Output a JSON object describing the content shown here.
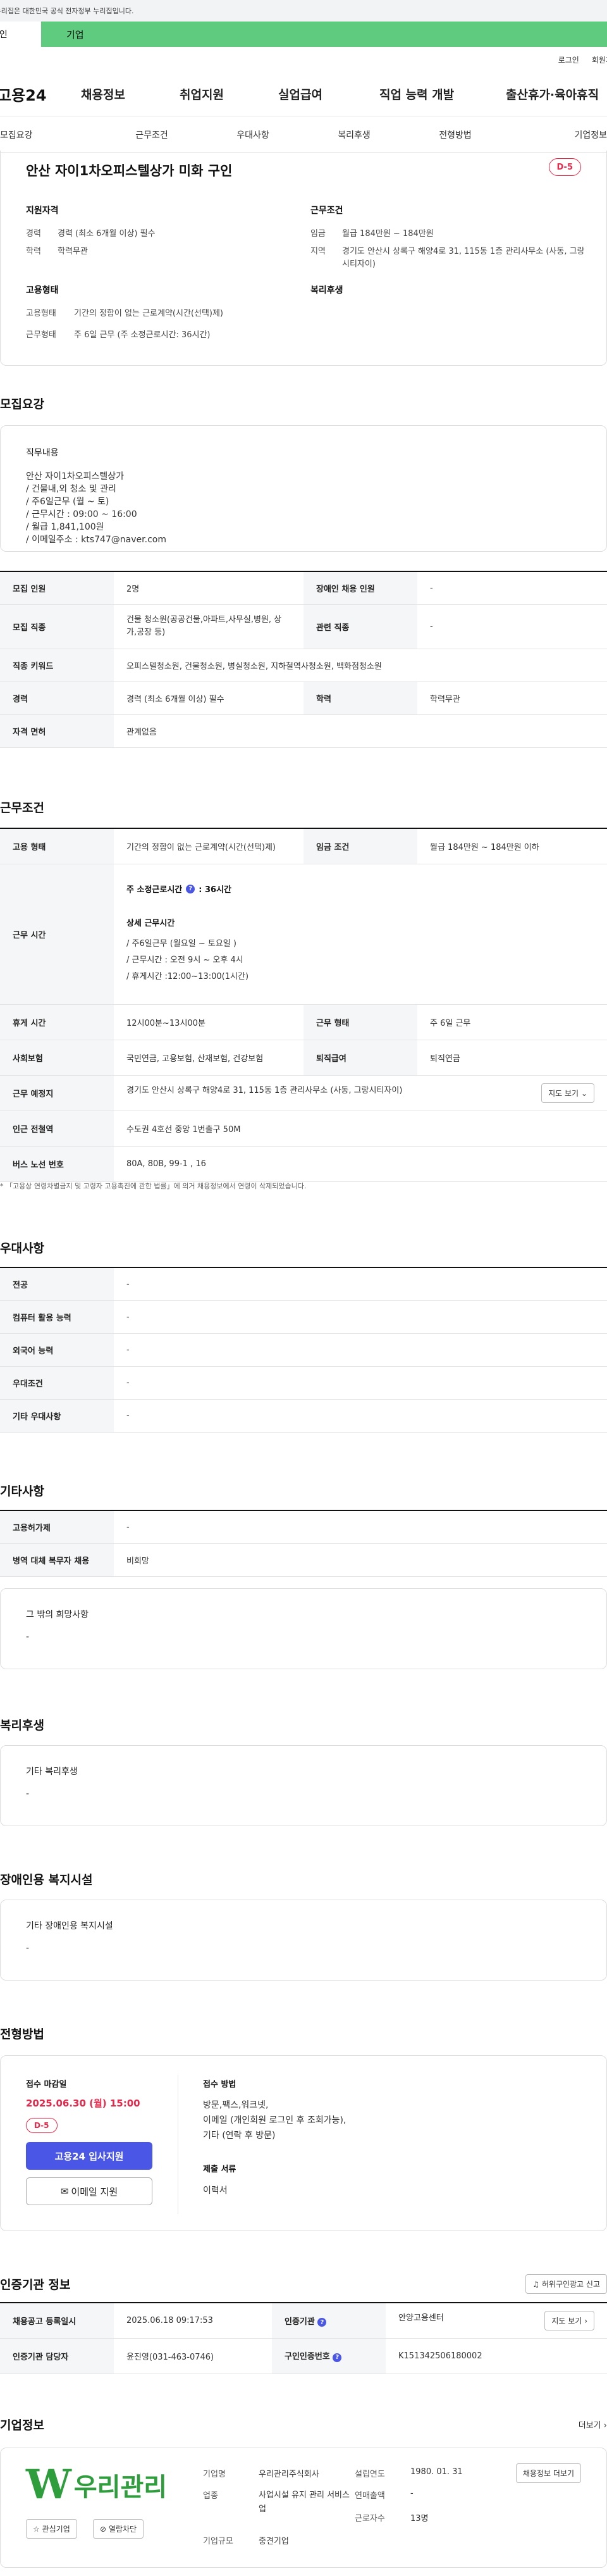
{
  "gov_banner": "이 누리집은 대한민국 공식 전자정부 누리집입니다.",
  "audience": {
    "tab1": "개인",
    "tab2": "기업"
  },
  "util": {
    "login": "로그인",
    "join": "회원가입"
  },
  "gnb": {
    "logo": "고용24",
    "items": [
      "채용정보",
      "취업지원",
      "실업급여",
      "직업 능력 개발",
      "출산휴가·육아휴직"
    ]
  },
  "subnav": [
    "모집요강",
    "근무조건",
    "우대사항",
    "복리후생",
    "전형방법",
    "기업정보"
  ],
  "job": {
    "title": "안산 자이1차오피스텔상가 미화 구인",
    "dday": "D-5",
    "qual_title": "지원자격",
    "qual": [
      {
        "k": "경력",
        "v": "경력 (최소 6개월 이상) 필수"
      },
      {
        "k": "학력",
        "v": "학력무관"
      }
    ],
    "cond_title": "근무조건",
    "cond": [
      {
        "k": "임금",
        "v": "월급 184만원 ~ 184만원"
      },
      {
        "k": "지역",
        "v": "경기도 안산시 상록구 해양4로 31, 115동 1층 관리사무소 (사동, 그랑시티자이)"
      }
    ],
    "emp_title": "고용형태",
    "emp": [
      {
        "k": "고용형태",
        "v": "기간의 정함이 없는 근로계약(시간(선택)제)"
      },
      {
        "k": "근무형태",
        "v": "주 6일 근무 (주 소정근로시간: 36시간)"
      }
    ],
    "welfare_title": "복리후생"
  },
  "recruit": {
    "title": "모집요강",
    "duty_title": "직무내용",
    "duty_lines": [
      "안산 자이1차오피스텔상가",
      "/ 건물내,외 청소 및 관리",
      "/ 주6일근무 (월 ~ 토)",
      "/ 근무시간 : 09:00 ~ 16:00",
      "/ 월급 1,841,100원",
      "/ 이메일주소 : kts747@naver.com"
    ],
    "rows": [
      {
        "h1": "모집 인원",
        "v1": "2명",
        "h2": "장애인 채용 인원",
        "v2": "-"
      },
      {
        "h1": "모집 직종",
        "v1": "건물 청소원(공공건물,아파트,사무실,병원, 상가,공장 등)",
        "h2": "관련 직종",
        "v2": "-"
      },
      {
        "h1": "직종 키워드",
        "v1": "오피스텔청소원, 건물청소원, 병실청소원, 지하철역사청소원, 백화점청소원"
      },
      {
        "h1": "경력",
        "v1": "경력 (최소 6개월 이상) 필수",
        "h2": "학력",
        "v2": "학력무관"
      },
      {
        "h1": "자격 면허",
        "v1": "관계없음"
      }
    ]
  },
  "work": {
    "title": "근무조건",
    "r1": {
      "h1": "고용 형태",
      "v1": "기간의 정함이 없는 근로계약(시간(선택)제)",
      "h2": "임금 조건",
      "v2": "월급 184만원 ~ 184만원 이하"
    },
    "hours_h": "근무 시간",
    "hours_main": "주 소정근로시간",
    "hours_main_v": ": 36시간",
    "hours_detail_title": "상세 근무시간",
    "hours_detail": [
      "/ 주6일근무 (월요일 ~ 토요일 )",
      "/ 근무시간 : 오전 9시 ~ 오후 4시",
      "/ 휴게시간 :12:00~13:00(1시간)"
    ],
    "r3": {
      "h1": "휴게 시간",
      "v1": "12시00분~13시00분",
      "h2": "근무 형태",
      "v2": "주 6일 근무"
    },
    "r4": {
      "h1": "사회보험",
      "v1": "국민연금, 고용보험, 산재보험, 건강보험",
      "h2": "퇴직급여",
      "v2": "퇴직연금"
    },
    "r5": {
      "h1": "근무 예정지",
      "v1": "경기도 안산시 상록구 해양4로 31, 115동 1층 관리사무소 (사동, 그랑시티자이)",
      "btn": "지도 보기"
    },
    "r6": {
      "h1": "인근 전철역",
      "v1": "수도권 4호선 중앙 1번출구 50M"
    },
    "r7": {
      "h1": "버스 노선 번호",
      "v1": "80A, 80B, 99-1 , 16"
    },
    "note": "* 「고용상 연령차별금지 및 고령자 고용촉진에 관한 법률」에 의거 채용정보에서 연령이 삭제되었습니다."
  },
  "prefer": {
    "title": "우대사항",
    "rows": [
      {
        "h": "전공",
        "v": "-"
      },
      {
        "h": "컴퓨터 활용 능력",
        "v": "-"
      },
      {
        "h": "외국어 능력",
        "v": "-"
      },
      {
        "h": "우대조건",
        "v": "-"
      },
      {
        "h": "기타 우대사항",
        "v": "-"
      }
    ]
  },
  "etc": {
    "title": "기타사항",
    "rows": [
      {
        "h": "고용허가제",
        "v": "-"
      },
      {
        "h": "병역 대체 복무자 채용",
        "v": "비희망"
      }
    ],
    "box_title": "그 밖의 희망사항",
    "box_val": "-"
  },
  "welfare": {
    "title": "복리후생",
    "box_title": "기타 복리후생",
    "box_val": "-"
  },
  "disab": {
    "title": "장애인용 복지시설",
    "box_title": "기타 장애인용 복지시설",
    "box_val": "-"
  },
  "select": {
    "title": "전형방법",
    "deadline_title": "접수 마감일",
    "deadline": "2025.06.30 (월) 15:00",
    "dday": "D-5",
    "apply_btn": "고용24 입사지원",
    "email_btn": "이메일 지원",
    "method_title": "접수 방법",
    "method_lines": [
      "방문,팩스,워크넷,",
      "이메일 (개인회원 로그인 후 조회가능),",
      "기타 (연락 후 방문)"
    ],
    "docs_title": "제출 서류",
    "docs_val": "이력서"
  },
  "cert": {
    "title": "인증기관 정보",
    "report_btn": "허위구인광고 신고",
    "rows": [
      {
        "h1": "채용공고 등록일시",
        "v1": "2025.06.18 09:17:53",
        "h2": "인증기관",
        "v2": "안양고용센터",
        "btn": "지도 보기"
      },
      {
        "h1": "인증기관 담당자",
        "v1": "윤진영(031-463-0746)",
        "h2": "구인인증번호",
        "v2": "K151342506180002"
      }
    ]
  },
  "company": {
    "title": "기업정보",
    "more": "더보기",
    "logo_text": "우리관리",
    "fav": "관심기업",
    "block": "열람차단",
    "k1": "기업명",
    "v1": "우리관리주식회사",
    "k2": "업종",
    "v2": "사업시설 유지 관리 서비스업",
    "k3": "기업규모",
    "v3": "중견기업",
    "k4": "설립연도",
    "v4": "1980. 01. 31",
    "k5": "연매출액",
    "v5": "-",
    "k6": "근로자수",
    "v6": "13명",
    "btn": "채용정보 더보기"
  },
  "colors": {
    "brand_green": "#5fcb7e",
    "accent_blue": "#4a57e6",
    "dday_red": "#e8284b",
    "deadline_red": "#e8284b"
  }
}
